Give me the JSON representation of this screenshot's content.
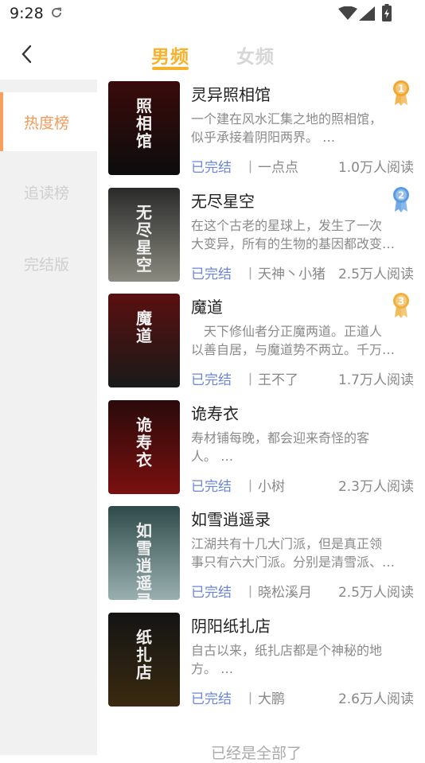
{
  "status_bar": {
    "time": "9:28"
  },
  "tabs": {
    "male": "男频",
    "female": "女频"
  },
  "sidebar": {
    "items": [
      {
        "label": "热度榜"
      },
      {
        "label": "追读榜"
      },
      {
        "label": "完结版"
      }
    ]
  },
  "books": [
    {
      "title": "灵异照相馆",
      "desc_line1": "一个建在风水汇集之地的照相馆，",
      "desc_line2": "似乎承接着阴阳两界。 …",
      "status": "已完结",
      "sep": "丨",
      "author": "一点点",
      "readers": "1.0万人阅读",
      "rank": "1",
      "cover_text": "照相馆",
      "cover_colors": [
        "#3a0b0b",
        "#0c0c0c"
      ]
    },
    {
      "title": "无尽星空",
      "desc_line1": "在这个古老的星球上，发生了一次",
      "desc_line2": "大变异，所有的生物的基因都改变…",
      "status": "已完结",
      "sep": "丨",
      "author": "天神丶小猪",
      "readers": "2.5万人阅读",
      "rank": "2",
      "cover_text": "无尽星空",
      "cover_colors": [
        "#2a2a2a",
        "#8a8a80"
      ]
    },
    {
      "title": "魔道",
      "desc_line1": "　天下修仙者分正魔两道。正道人",
      "desc_line2": "以善自居，与魔道势不两立。千万…",
      "status": "已完结",
      "sep": "丨",
      "author": "王不了",
      "readers": "1.7万人阅读",
      "rank": "3",
      "cover_text": "魔道",
      "cover_colors": [
        "#5a0f0f",
        "#1a1a1a"
      ]
    },
    {
      "title": "诡寿衣",
      "desc_line1": "寿材铺每晚，都会迎来奇怪的客",
      "desc_line2": "人。 …",
      "status": "已完结",
      "sep": "丨",
      "author": "小树",
      "readers": "2.3万人阅读",
      "rank": "",
      "cover_text": "诡寿衣",
      "cover_colors": [
        "#2a0a0a",
        "#7a1010"
      ]
    },
    {
      "title": "如雪逍遥录",
      "desc_line1": "江湖共有十几大门派，但是真正领",
      "desc_line2": "事只有六大门派。分别是清雪派、…",
      "status": "已完结",
      "sep": "丨",
      "author": "晓松溪月",
      "readers": "2.5万人阅读",
      "rank": "",
      "cover_text": "如雪逍遥录",
      "cover_colors": [
        "#2f4a4a",
        "#9ab0b0"
      ]
    },
    {
      "title": "阴阳纸扎店",
      "desc_line1": "自古以来，纸扎店都是个神秘的地",
      "desc_line2": "方。 …",
      "status": "已完结",
      "sep": "丨",
      "author": "大鹏",
      "readers": "2.6万人阅读",
      "rank": "",
      "cover_text": "纸扎店",
      "cover_colors": [
        "#141414",
        "#3a2a10"
      ]
    }
  ],
  "footer": {
    "text": "已经是全部了"
  },
  "colors": {
    "accent": "#f7b22d",
    "sidebar_active": "#f39a5a",
    "status_blue": "#6a86d8",
    "gold_medal": "#f0a830",
    "silver_medal": "#5a9ae0",
    "bronze_medal": "#f0b040"
  }
}
